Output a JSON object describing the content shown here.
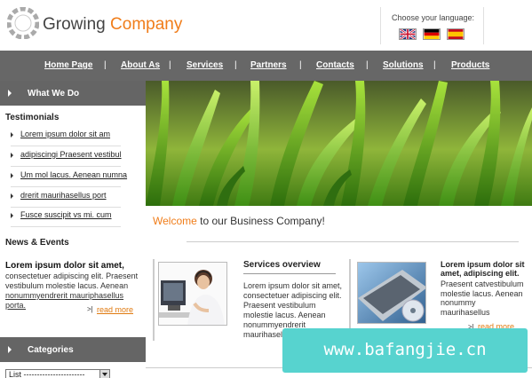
{
  "header": {
    "brand_part1": "Growing",
    "brand_part2": "Company",
    "language_label": "Choose your language:",
    "flags": [
      "uk-flag-icon",
      "germany-flag-icon",
      "spain-flag-icon"
    ]
  },
  "nav": {
    "items": [
      "Home Page",
      "About As",
      "Services",
      "Partners",
      "Contacts",
      "Solutions",
      "Products"
    ],
    "separator": "|"
  },
  "sidebar": {
    "what_we_do": "What We Do",
    "testimonials_title": "Testimonials",
    "testimonials": [
      "Lorem ipsum dolor sit am",
      "adipiscingi Praesent vestibul",
      "Um mol lacus. Aenean numna",
      "drerit maurihasellus port",
      "Fusce suscipit vs mi. cum"
    ],
    "news_title": "News & Events",
    "news_headline": "Lorem ipsum dolor sit amet,",
    "news_body": "consectetuer adipiscing elit. Praesent vestibulum molestie lacus. Aenean",
    "news_link_text": "nonummyendrerit mauriphasellus porta.",
    "read_more": "read more",
    "categories": "Categories",
    "select_value": "List -----------------------"
  },
  "main": {
    "welcome_part1": "Welcome",
    "welcome_part2": " to our Business Company!",
    "services_title": "Services overview",
    "services_text": "Lorem ipsum dolor sit amet, consectetuer adipiscing elit. Praesent vestibulum molestie lacus. Aenean nonummyendrerit maurihasellus",
    "right_title": "Lorem ipsum dolor sit amet, adipiscing elit.",
    "right_text": "Praesent catvestibulum molestie lacus. Aenean nonummy maurihasellus",
    "read_more": "read more"
  },
  "watermark": "www.bafangjie.cn",
  "colors": {
    "accent": "#f07d1a",
    "nav_bg": "#676767",
    "side_head_bg": "#656565",
    "watermark_bg": "#57d3cf"
  }
}
